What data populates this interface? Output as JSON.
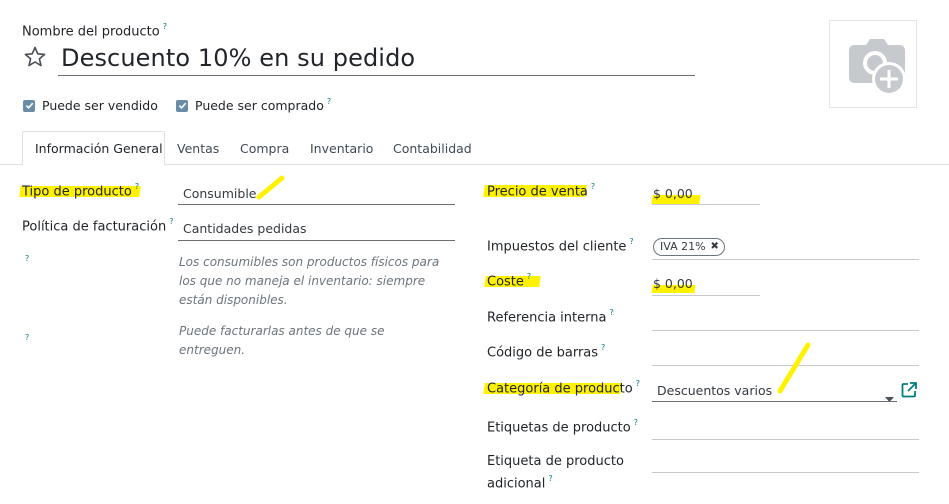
{
  "header": {
    "name_label": "Nombre del producto",
    "help_mark": "?",
    "product_name": "Descuento 10% en su pedido",
    "can_be_sold": "Puede ser vendido",
    "can_be_purchased": "Puede ser comprado",
    "can_be_sold_checked": true,
    "can_be_purchased_checked": true
  },
  "tabs": [
    {
      "label": "Información General",
      "active": true
    },
    {
      "label": "Ventas",
      "active": false
    },
    {
      "label": "Compra",
      "active": false
    },
    {
      "label": "Inventario",
      "active": false
    },
    {
      "label": "Contabilidad",
      "active": false
    }
  ],
  "left": {
    "product_type_label": "Tipo de producto",
    "product_type_value": "Consumible",
    "invoice_policy_label": "Política de facturación",
    "invoice_policy_value": "Cantidades pedidas",
    "help_consumable": "Los consumibles son productos físicos para los que no maneja el inventario: siempre están disponibles.",
    "help_invoice": "Puede facturarlas antes de que se entreguen."
  },
  "right": {
    "sale_price_label": "Precio de venta",
    "sale_price_value": "$ 0,00",
    "customer_taxes_label": "Impuestos del cliente",
    "customer_taxes_tag": "IVA 21%",
    "cost_label": "Coste",
    "cost_value": "$ 0,00",
    "internal_ref_label": "Referencia interna",
    "barcode_label": "Código de barras",
    "category_label": "Categoría de producto",
    "category_value": "Descuentos varios",
    "product_tags_label": "Etiquetas de producto",
    "extra_tag_label_line1": "Etiqueta de producto",
    "extra_tag_label_line2": "adicional"
  },
  "colors": {
    "accent": "#017e84",
    "highlight": "#fff200",
    "checkbox": "#6a8ca6"
  },
  "icons": {
    "favorite": "star-outline-icon",
    "image_placeholder": "camera-plus-icon",
    "dropdown": "caret-down-icon",
    "external_link": "external-link-icon",
    "remove_tag": "close-icon"
  }
}
